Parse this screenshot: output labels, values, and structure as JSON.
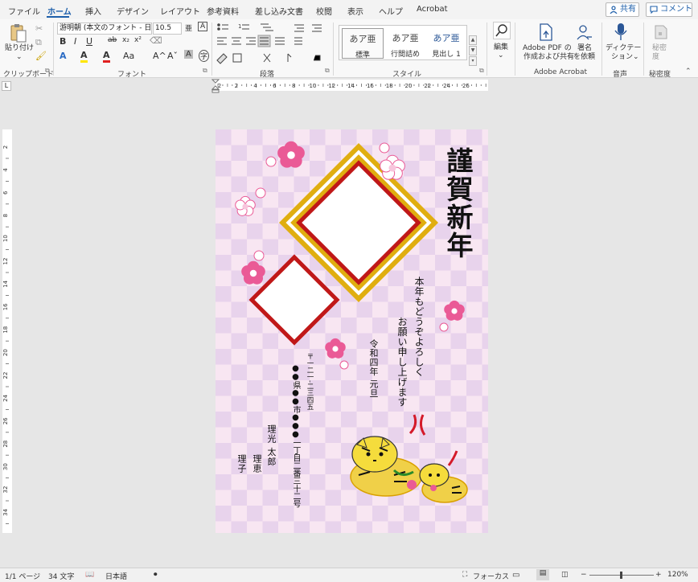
{
  "menu": {
    "tabs": [
      "ファイル",
      "ホーム",
      "挿入",
      "デザイン",
      "レイアウト",
      "参考資料",
      "差し込み文書",
      "校閲",
      "表示",
      "ヘルプ",
      "Acrobat"
    ],
    "active_tab": "ホーム",
    "share_label": "共有",
    "comment_label": "コメント"
  },
  "ribbon": {
    "clipboard": {
      "paste_label": "貼り付け",
      "group_label": "クリップボード"
    },
    "font": {
      "font_name": "游明朝 (本文のフォント - 日本",
      "font_size": "10.5",
      "bold": "B",
      "italic": "I",
      "underline": "U",
      "strike": "ab",
      "subscript": "x₂",
      "superscript": "x²",
      "font_color_glyph": "A",
      "highlight_glyph": "A",
      "size_glyph": "Aa",
      "grow_glyph": "A^",
      "shrink_glyph": "Aˇ",
      "char_shading_glyph": "A",
      "ruby_glyph": "亜",
      "encircle_glyph": "字",
      "border_glyph": "A",
      "group_label": "フォント"
    },
    "paragraph": {
      "group_label": "段落"
    },
    "styles": {
      "items": [
        {
          "preview": "あア亜",
          "name": "標準"
        },
        {
          "preview": "あア亜",
          "name": "行間詰め"
        },
        {
          "preview": "あア亜",
          "name": "見出し 1"
        }
      ],
      "group_label": "スタイル"
    },
    "editing": {
      "label": "編集"
    },
    "acrobat": {
      "create_pdf_line1": "Adobe PDF の",
      "create_pdf_line2": "作成および共有",
      "sign_line1": "署名",
      "sign_line2": "を依頼",
      "group_label": "Adobe Acrobat"
    },
    "voice": {
      "dictate_label": "ディクテー",
      "dictate_label2": "ション",
      "group_label": "音声"
    },
    "sensitivity": {
      "label": "秘密",
      "label2": "度",
      "group_label": "秘密度"
    }
  },
  "ruler": {
    "h_numbers": [
      "2",
      "2",
      "4",
      "6",
      "8",
      "10",
      "12",
      "14",
      "16",
      "18",
      "20",
      "22",
      "24",
      "26"
    ],
    "v_numbers": [
      "2",
      "4",
      "6",
      "8",
      "10",
      "12",
      "14",
      "16",
      "18",
      "20",
      "22",
      "24",
      "26",
      "28",
      "30",
      "32",
      "34"
    ],
    "corner": "L"
  },
  "card": {
    "greeting": "謹賀新年",
    "message_line1": "本年もどうぞよろしく",
    "message_line2": "お願い申し上げます",
    "date": "令和四年 元旦",
    "postal": "〒一二一-二三四五",
    "address_line1": "●●県●●市●●●一丁目二番三十二号",
    "names": [
      "理光 太郎",
      "理恵",
      "理子"
    ],
    "colors": {
      "check_light": "#f8e6f2",
      "check_dark": "#e8d3ec",
      "gold": "#e0ae10",
      "red": "#c01818",
      "blossom": "#ea5a96"
    }
  },
  "status": {
    "page": "1/1 ページ",
    "words": "34 文字",
    "language": "日本語",
    "focus": "フォーカス",
    "zoom": "120%"
  }
}
